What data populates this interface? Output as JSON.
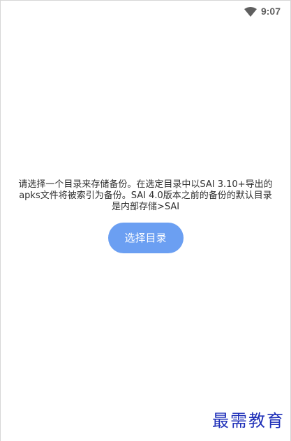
{
  "status_bar": {
    "time": "9:07",
    "wifi_icon": "wifi-icon"
  },
  "main": {
    "message": "请选择一个目录来存储备份。在选定目录中以SAI 3.10+导出的\napks文件将被索引为备份。SAI 4.0版本之前的备份的默认目录\n是内部存储>SAI",
    "button_label": "选择目录",
    "button_color": "#6b9ff2"
  },
  "watermark": {
    "text": "最需教育"
  }
}
